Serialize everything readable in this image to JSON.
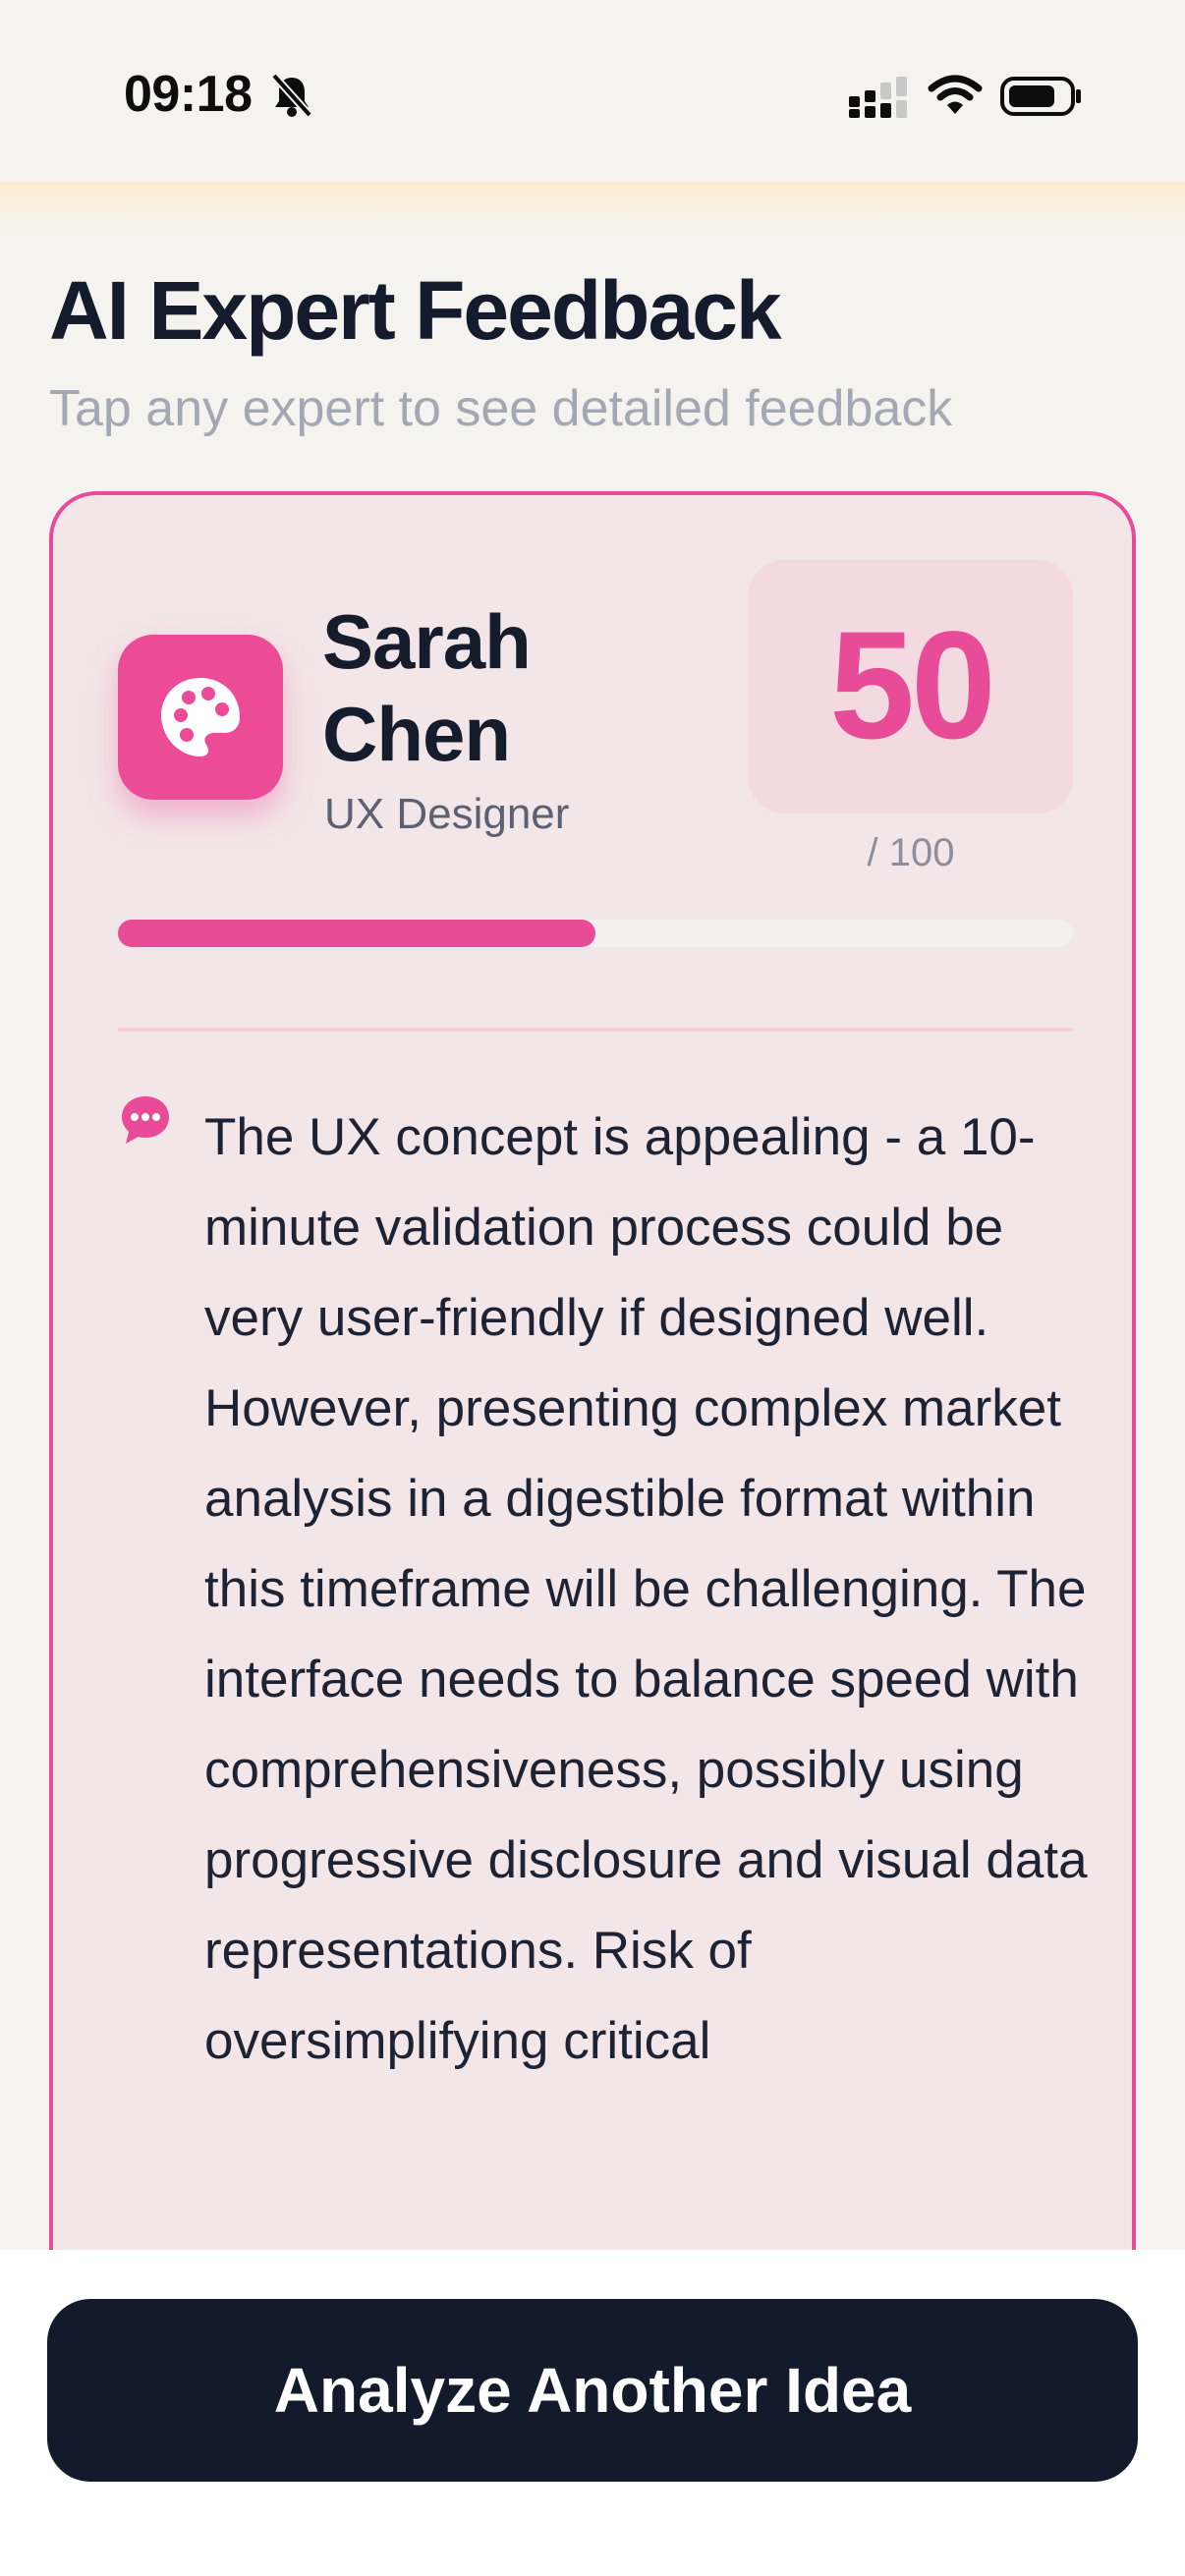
{
  "status_bar": {
    "time": "09:18",
    "icons": [
      "bell-slash-icon",
      "cellular-signal-icon",
      "wifi-icon",
      "battery-icon"
    ]
  },
  "page": {
    "title": "AI Expert Feedback",
    "subtitle": "Tap any expert to see detailed feedback"
  },
  "expert": {
    "name": "Sarah Chen",
    "role": "UX Designer",
    "avatar_icon": "palette-icon",
    "score": "50",
    "score_max": "/ 100",
    "score_fraction": 0.5,
    "accent_color": "#e84b98",
    "feedback": "The UX concept is appealing - a 10-minute validation process could be very user-friendly if designed well. However, presenting complex market analysis in a digestible format within this timeframe will be challenging. The interface needs to balance speed with comprehensiveness, possibly using progressive disclosure and visual data representations. Risk of oversimplifying critical"
  },
  "actions": {
    "primary_label": "Analyze Another Idea"
  },
  "colors": {
    "background": "#f5f3ef",
    "card_background": "#f3e6e8",
    "button_background": "#121a2b"
  }
}
